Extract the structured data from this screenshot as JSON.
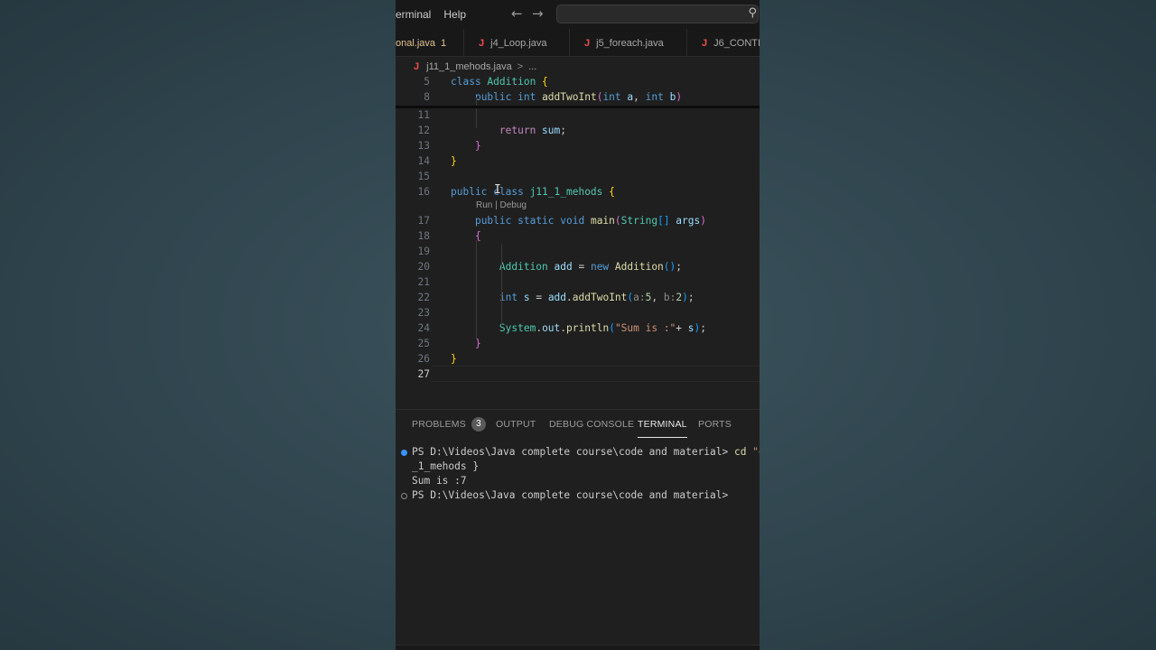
{
  "menubar": {
    "items": [
      "erminal",
      "Help"
    ],
    "back_icon": "arrow-left-icon",
    "forward_icon": "arrow-right-icon",
    "search_icon": "search-icon"
  },
  "tabs": [
    {
      "name": "onal.java",
      "badge": "1",
      "modified": true
    },
    {
      "name": "j4_Loop.java",
      "badge": "",
      "modified": false
    },
    {
      "name": "j5_foreach.java",
      "badge": "",
      "modified": false
    },
    {
      "name": "J6_CONTI",
      "badge": "",
      "modified": false
    }
  ],
  "file_icon_letter": "J",
  "breadcrumb": {
    "file": "j11_1_mehods.java",
    "chevron": ">",
    "more": "..."
  },
  "code": {
    "lines": [
      {
        "n": "5",
        "tokens": [
          [
            "kw",
            "class "
          ],
          [
            "ty",
            "Addition "
          ],
          [
            "b1",
            "{"
          ]
        ]
      },
      {
        "n": "8",
        "tokens": [
          [
            "",
            "    "
          ],
          [
            "kw",
            "public "
          ],
          [
            "kw",
            "int "
          ],
          [
            "fn",
            "addTwoInt"
          ],
          [
            "b2",
            "("
          ],
          [
            "kw",
            "int "
          ],
          [
            "va",
            "a"
          ],
          [
            "",
            ", "
          ],
          [
            "kw",
            "int "
          ],
          [
            "va",
            "b"
          ],
          [
            "b2",
            ")"
          ]
        ]
      },
      {
        "n": "11",
        "tokens": []
      },
      {
        "n": "12",
        "tokens": [
          [
            "",
            "        "
          ],
          [
            "kwc",
            "return "
          ],
          [
            "va",
            "sum"
          ],
          [
            "",
            ";"
          ]
        ]
      },
      {
        "n": "13",
        "tokens": [
          [
            "",
            "    "
          ],
          [
            "b2",
            "}"
          ]
        ]
      },
      {
        "n": "14",
        "tokens": [
          [
            "b1",
            "}"
          ]
        ]
      },
      {
        "n": "15",
        "tokens": []
      },
      {
        "n": "16",
        "tokens": [
          [
            "kw",
            "public "
          ],
          [
            "kw",
            "class "
          ],
          [
            "ty",
            "j11_1_mehods "
          ],
          [
            "b1",
            "{"
          ]
        ]
      },
      {
        "n": "17",
        "tokens": [
          [
            "",
            "    "
          ],
          [
            "kw",
            "public "
          ],
          [
            "kw",
            "static "
          ],
          [
            "kw",
            "void "
          ],
          [
            "fn",
            "main"
          ],
          [
            "b2",
            "("
          ],
          [
            "ty",
            "String"
          ],
          [
            "b3",
            "[]"
          ],
          [
            "va",
            " args"
          ],
          [
            "b2",
            ")"
          ]
        ]
      },
      {
        "n": "18",
        "tokens": [
          [
            "",
            "    "
          ],
          [
            "b2",
            "{"
          ]
        ]
      },
      {
        "n": "19",
        "tokens": []
      },
      {
        "n": "20",
        "tokens": [
          [
            "",
            "        "
          ],
          [
            "ty",
            "Addition "
          ],
          [
            "va",
            "add"
          ],
          [
            "",
            " = "
          ],
          [
            "kw",
            "new "
          ],
          [
            "fn",
            "Addition"
          ],
          [
            "b3",
            "()"
          ],
          [
            "",
            ";"
          ]
        ]
      },
      {
        "n": "21",
        "tokens": []
      },
      {
        "n": "22",
        "tokens": [
          [
            "",
            "        "
          ],
          [
            "kw",
            "int "
          ],
          [
            "va",
            "s"
          ],
          [
            "",
            " = "
          ],
          [
            "va",
            "add"
          ],
          [
            "",
            "."
          ],
          [
            "fn",
            "addTwoInt"
          ],
          [
            "b3",
            "("
          ],
          [
            "hint",
            "a:"
          ],
          [
            "nu",
            "5"
          ],
          [
            "",
            ", "
          ],
          [
            "hint",
            "b:"
          ],
          [
            "nu",
            "2"
          ],
          [
            "b3",
            ")"
          ],
          [
            "",
            ";"
          ]
        ]
      },
      {
        "n": "23",
        "tokens": []
      },
      {
        "n": "24",
        "tokens": [
          [
            "",
            "        "
          ],
          [
            "ty",
            "System"
          ],
          [
            "",
            "."
          ],
          [
            "va",
            "out"
          ],
          [
            "",
            "."
          ],
          [
            "fn",
            "println"
          ],
          [
            "b3",
            "("
          ],
          [
            "st",
            "\"Sum is :\""
          ],
          [
            "",
            "+ "
          ],
          [
            "va",
            "s"
          ],
          [
            "b3",
            ")"
          ],
          [
            "",
            ";"
          ]
        ]
      },
      {
        "n": "25",
        "tokens": [
          [
            "",
            "    "
          ],
          [
            "b2",
            "}"
          ]
        ]
      },
      {
        "n": "26",
        "tokens": [
          [
            "b1",
            "}"
          ]
        ]
      },
      {
        "n": "27",
        "tokens": [],
        "active": true
      }
    ],
    "codelens": "Run | Debug"
  },
  "panel": {
    "tabs": [
      {
        "label": "PROBLEMS",
        "badge": "3",
        "active": false
      },
      {
        "label": "OUTPUT",
        "badge": "",
        "active": false
      },
      {
        "label": "DEBUG CONSOLE",
        "badge": "",
        "active": false
      },
      {
        "label": "TERMINAL",
        "badge": "",
        "active": true
      },
      {
        "label": "PORTS",
        "badge": "",
        "active": false
      }
    ]
  },
  "terminal": {
    "line1_prompt": "PS D:\\Videos\\Java complete course\\code and material> ",
    "line1_cmd": "cd",
    "line1_arg": " \"d:\\",
    "line2": "_1_mehods }",
    "line3": "Sum is :7",
    "line4": "PS D:\\Videos\\Java complete course\\code and material>"
  },
  "colors": {
    "editor_bg": "#1f1f1f",
    "keyword": "#569cd6",
    "type": "#4ec9b0",
    "function": "#dcdcaa",
    "variable": "#9cdcfe",
    "string": "#ce9178",
    "accent": "#3794ff"
  }
}
